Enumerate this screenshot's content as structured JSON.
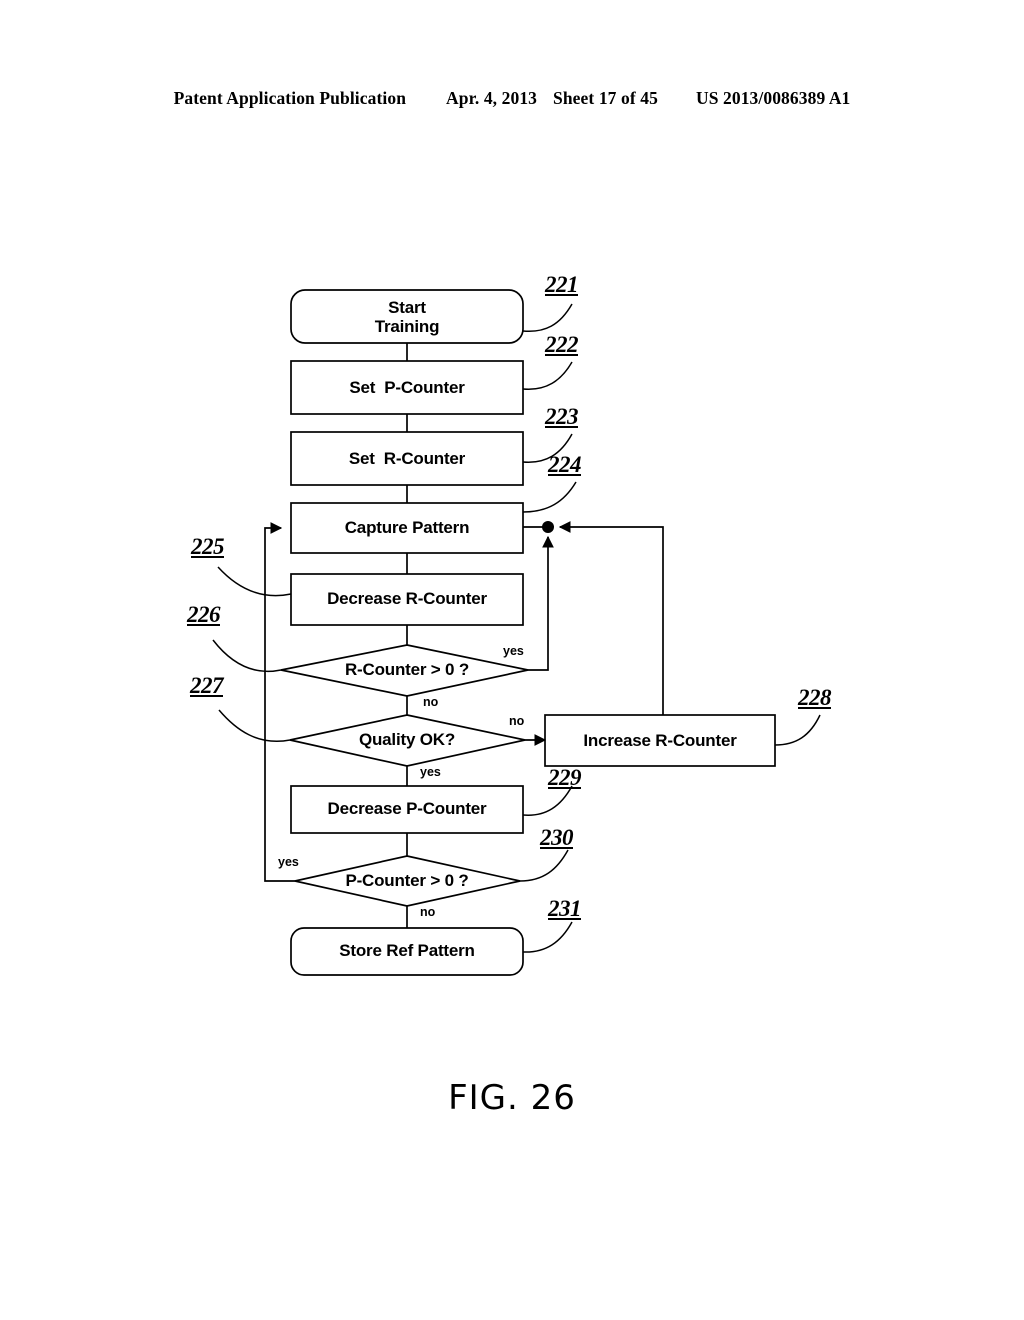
{
  "header": {
    "publication": "Patent Application Publication",
    "date": "Apr. 4, 2013",
    "sheet": "Sheet 17 of 45",
    "pubnumber": "US 2013/0086389 A1"
  },
  "figure": {
    "caption": "FIG. 26",
    "nodes": [
      {
        "id": "start",
        "label": "Start\nTraining",
        "shape": "terminator",
        "ref": "221"
      },
      {
        "id": "setp",
        "label": "Set  P-Counter",
        "shape": "process",
        "ref": "222"
      },
      {
        "id": "setr",
        "label": "Set  R-Counter",
        "shape": "process",
        "ref": "223"
      },
      {
        "id": "capture",
        "label": "Capture Pattern",
        "shape": "process",
        "ref": "224"
      },
      {
        "id": "decr",
        "label": "Decrease R-Counter",
        "shape": "process",
        "ref": "225"
      },
      {
        "id": "rcheck",
        "label": "R-Counter > 0 ?",
        "shape": "decision",
        "ref": "226"
      },
      {
        "id": "quality",
        "label": "Quality OK?",
        "shape": "decision",
        "ref": "227"
      },
      {
        "id": "incr",
        "label": "Increase R-Counter",
        "shape": "process",
        "ref": "228"
      },
      {
        "id": "decp",
        "label": "Decrease P-Counter",
        "shape": "process",
        "ref": "229"
      },
      {
        "id": "pcheck",
        "label": "P-Counter > 0 ?",
        "shape": "decision",
        "ref": "230"
      },
      {
        "id": "store",
        "label": "Store Ref Pattern",
        "shape": "terminator",
        "ref": "231"
      }
    ],
    "edge_labels": [
      {
        "id": "rcheck-yes",
        "text": "yes",
        "from": "rcheck",
        "branch": "yes"
      },
      {
        "id": "rcheck-no",
        "text": "no",
        "from": "rcheck",
        "branch": "no"
      },
      {
        "id": "quality-no",
        "text": "no",
        "from": "quality",
        "branch": "no"
      },
      {
        "id": "quality-yes",
        "text": "yes",
        "from": "quality",
        "branch": "yes"
      },
      {
        "id": "pcheck-yes",
        "text": "yes",
        "from": "pcheck",
        "branch": "yes"
      },
      {
        "id": "pcheck-no",
        "text": "no",
        "from": "pcheck",
        "branch": "no"
      }
    ],
    "refnums": {
      "n221": "221",
      "n222": "222",
      "n223": "223",
      "n224": "224",
      "n225": "225",
      "n226": "226",
      "n227": "227",
      "n228": "228",
      "n229": "229",
      "n230": "230",
      "n231": "231"
    }
  },
  "colors": {
    "ink": "#000000",
    "paper": "#ffffff"
  }
}
